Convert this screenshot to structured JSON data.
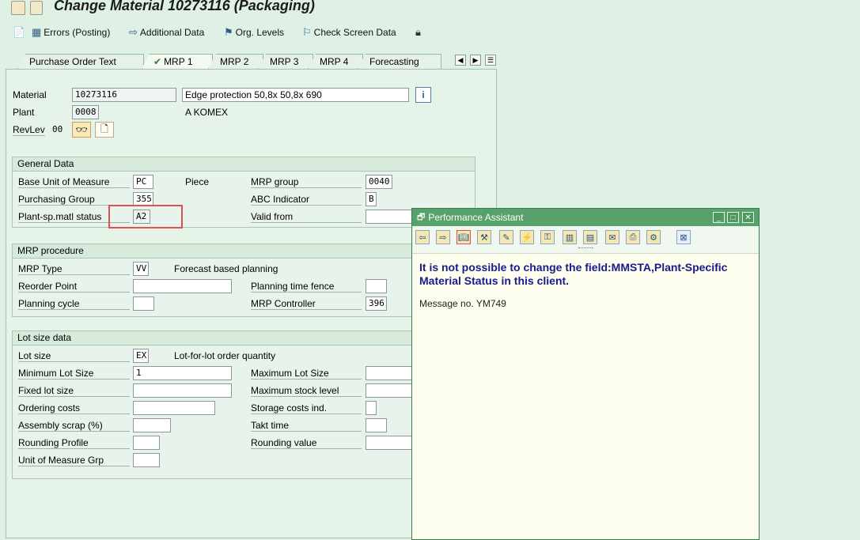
{
  "window": {
    "title": "Change Material 10273116 (Packaging)"
  },
  "toolbar": {
    "errors_label": "Errors (Posting)",
    "additional_data_label": "Additional Data",
    "org_levels_label": "Org. Levels",
    "check_screen_label": "Check Screen Data"
  },
  "tabs": [
    {
      "label": "Purchase Order Text"
    },
    {
      "label": "MRP 1"
    },
    {
      "label": "MRP 2"
    },
    {
      "label": "MRP 3"
    },
    {
      "label": "MRP 4"
    },
    {
      "label": "Forecasting"
    }
  ],
  "header": {
    "material_label": "Material",
    "material_value": "10273116",
    "material_desc": "Edge protection 50,8x 50,8x 690",
    "plant_label": "Plant",
    "plant_value": "0008",
    "plant_name": "A KOMEX",
    "revlev_label": "RevLev",
    "revlev_value": "00"
  },
  "general": {
    "title": "General Data",
    "base_uom_label": "Base Unit of Measure",
    "base_uom_value": "PC",
    "base_uom_text": "Piece",
    "mrp_group_label": "MRP group",
    "mrp_group_value": "0040",
    "purch_group_label": "Purchasing Group",
    "purch_group_value": "355",
    "abc_label": "ABC Indicator",
    "abc_value": "B",
    "status_label": "Plant-sp.matl status",
    "status_value": "A2",
    "valid_from_label": "Valid from"
  },
  "procedure": {
    "title": "MRP procedure",
    "mrp_type_label": "MRP Type",
    "mrp_type_value": "VV",
    "mrp_type_text": "Forecast based planning",
    "reorder_label": "Reorder Point",
    "fence_label": "Planning time fence",
    "cycle_label": "Planning cycle",
    "controller_label": "MRP Controller",
    "controller_value": "396"
  },
  "lotsize": {
    "title": "Lot size data",
    "lot_size_label": "Lot size",
    "lot_size_value": "EX",
    "lot_size_text": "Lot-for-lot order quantity",
    "min_label": "Minimum Lot Size",
    "min_value": "1",
    "max_label": "Maximum Lot Size",
    "fixed_label": "Fixed lot size",
    "max_stock_label": "Maximum stock level",
    "ordering_label": "Ordering costs",
    "storage_label": "Storage costs ind.",
    "scrap_label": "Assembly scrap (%)",
    "takt_label": "Takt time",
    "rounding_profile_label": "Rounding Profile",
    "rounding_value_label": "Rounding value",
    "uom_grp_label": "Unit of Measure Grp"
  },
  "assistant": {
    "title": "Performance Assistant",
    "message": "It is not possible to change the field:MMSTA,Plant-Specific Material Status in this client.",
    "message_no": "Message no. YM749"
  },
  "colors": {
    "background": "#dff0e4",
    "assistant_titlebar": "#57a26a",
    "message_text": "#1a1a8e",
    "highlight": "#e05050"
  },
  "icons": [
    "save-icon",
    "errors-icon",
    "arrow-right-icon",
    "org-levels-icon",
    "check-icon",
    "lock-icon",
    "info-icon",
    "glasses-icon",
    "document-icon"
  ]
}
